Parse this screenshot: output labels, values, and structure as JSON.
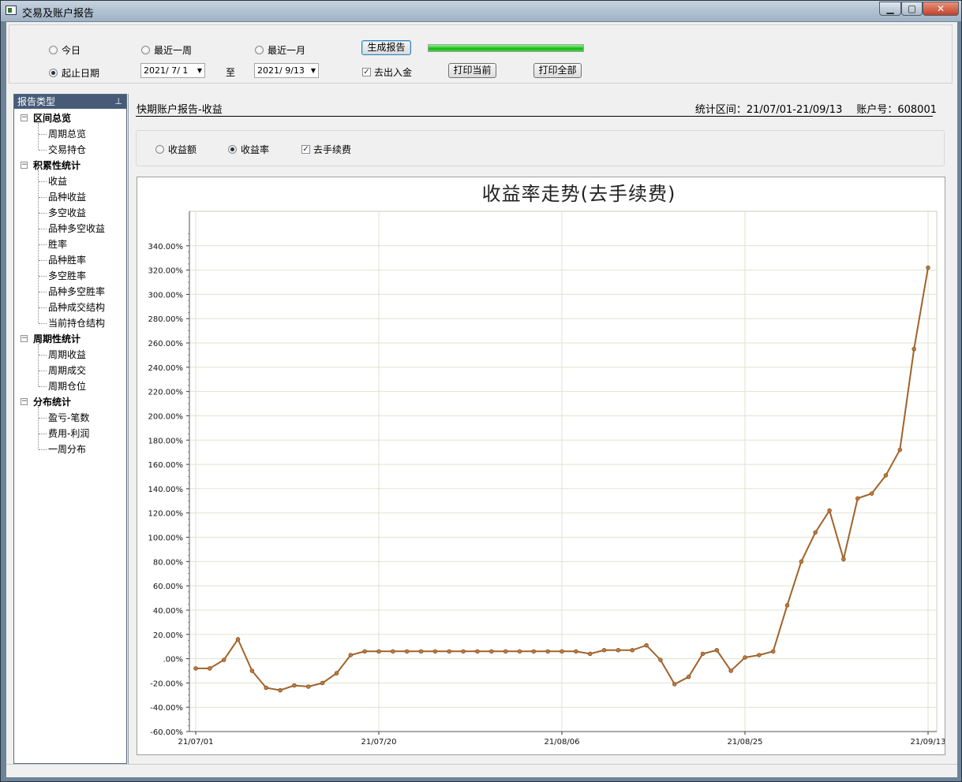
{
  "window": {
    "title": "交易及账户报告"
  },
  "toolbar": {
    "range_today": "今日",
    "range_week": "最近一周",
    "range_month": "最近一月",
    "range_custom": "起止日期",
    "start_date": "2021/ 7/ 1",
    "to_label": "至",
    "end_date": "2021/ 9/13",
    "generate_label": "生成报告",
    "exclude_deposit_label": "去出入金",
    "print_current_label": "打印当前",
    "print_all_label": "打印全部",
    "progress": 1.0
  },
  "sidebar": {
    "header": "报告类型",
    "groups": [
      {
        "label": "区间总览",
        "items": [
          "周期总览",
          "交易持仓"
        ]
      },
      {
        "label": "积累性统计",
        "items": [
          "收益",
          "品种收益",
          "多空收益",
          "品种多空收益",
          "胜率",
          "品种胜率",
          "多空胜率",
          "品种多空胜率",
          "品种成交结构",
          "当前持仓结构"
        ]
      },
      {
        "label": "周期性统计",
        "items": [
          "周期收益",
          "周期成交",
          "周期仓位"
        ]
      },
      {
        "label": "分布统计",
        "items": [
          "盈亏-笔数",
          "费用-利润",
          "一周分布"
        ]
      }
    ]
  },
  "report": {
    "title": "快期账户报告-收益",
    "period": "统计区间：21/07/01-21/09/13",
    "account": "账户号：608001",
    "opt_amount": "收益额",
    "opt_rate": "收益率",
    "opt_fee": "去手续费"
  },
  "chart_data": {
    "type": "line",
    "title": "收益率走势(去手续费)",
    "xlabel": "",
    "ylabel": "",
    "ylim": [
      -60,
      360
    ],
    "yticks": [
      -60,
      -40,
      -20,
      0,
      20,
      40,
      60,
      80,
      100,
      120,
      140,
      160,
      180,
      200,
      220,
      240,
      260,
      280,
      300,
      320,
      340
    ],
    "ytick_labels": [
      "-60.00%",
      "-40.00%",
      "-20.00%",
      ".00%",
      "20.00%",
      "40.00%",
      "60.00%",
      "80.00%",
      "100.00%",
      "120.00%",
      "140.00%",
      "160.00%",
      "180.00%",
      "200.00%",
      "220.00%",
      "240.00%",
      "260.00%",
      "280.00%",
      "300.00%",
      "320.00%",
      "340.00%"
    ],
    "xtick_labels": [
      "21/07/01",
      "21/07/20",
      "21/08/06",
      "21/08/25",
      "21/09/13"
    ],
    "xtick_index": [
      0,
      13,
      26,
      39,
      52
    ],
    "grid": true,
    "color": "#a0632a",
    "values": [
      -8,
      -8,
      -1,
      16,
      -10,
      -24,
      -26,
      -22,
      -23,
      -20,
      -12,
      3,
      6,
      6,
      6,
      6,
      6,
      6,
      6,
      6,
      6,
      6,
      6,
      6,
      6,
      6,
      6,
      6,
      4,
      7,
      7,
      7,
      11,
      -1,
      -21,
      -15,
      4,
      7,
      -10,
      1,
      3,
      6,
      44,
      80,
      104,
      122,
      82,
      132,
      136,
      151,
      172,
      255,
      322
    ]
  }
}
